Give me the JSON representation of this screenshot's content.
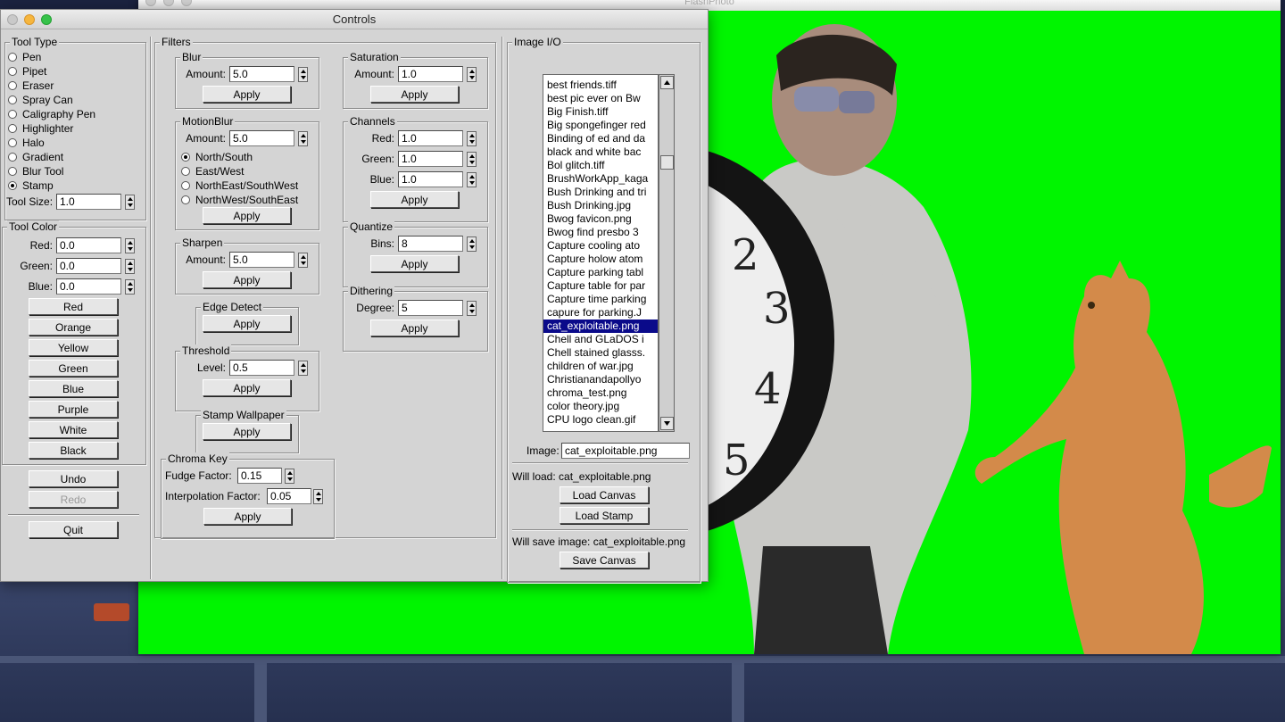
{
  "main_window": {
    "title": "FlashPhoto"
  },
  "controls_window": {
    "title": "Controls"
  },
  "tool_type": {
    "title": "Tool Type",
    "tools": [
      {
        "label": "Pen",
        "selected": false
      },
      {
        "label": "Pipet",
        "selected": false
      },
      {
        "label": "Eraser",
        "selected": false
      },
      {
        "label": "Spray Can",
        "selected": false
      },
      {
        "label": "Caligraphy Pen",
        "selected": false
      },
      {
        "label": "Highlighter",
        "selected": false
      },
      {
        "label": "Halo",
        "selected": false
      },
      {
        "label": "Gradient",
        "selected": false
      },
      {
        "label": "Blur Tool",
        "selected": false
      },
      {
        "label": "Stamp",
        "selected": true
      }
    ],
    "size_label": "Tool Size:",
    "size_value": "1.0"
  },
  "tool_color": {
    "title": "Tool Color",
    "red_label": "Red:",
    "red_value": "0.0",
    "green_label": "Green:",
    "green_value": "0.0",
    "blue_label": "Blue:",
    "blue_value": "0.0",
    "buttons": [
      "Red",
      "Orange",
      "Yellow",
      "Green",
      "Blue",
      "Purple",
      "White",
      "Black"
    ]
  },
  "history": {
    "undo": "Undo",
    "redo": "Redo",
    "quit": "Quit"
  },
  "filters": {
    "title": "Filters",
    "apply": "Apply",
    "blur": {
      "title": "Blur",
      "amount_label": "Amount:",
      "amount": "5.0"
    },
    "motion_blur": {
      "title": "MotionBlur",
      "amount_label": "Amount:",
      "amount": "5.0",
      "directions": [
        {
          "label": "North/South",
          "selected": true
        },
        {
          "label": "East/West",
          "selected": false
        },
        {
          "label": "NorthEast/SouthWest",
          "selected": false
        },
        {
          "label": "NorthWest/SouthEast",
          "selected": false
        }
      ]
    },
    "sharpen": {
      "title": "Sharpen",
      "amount_label": "Amount:",
      "amount": "5.0"
    },
    "edge_detect": {
      "title": "Edge Detect"
    },
    "threshold": {
      "title": "Threshold",
      "level_label": "Level:",
      "level": "0.5"
    },
    "stamp_wallpaper": {
      "title": "Stamp Wallpaper"
    },
    "chroma_key": {
      "title": "Chroma Key",
      "fudge_label": "Fudge Factor:",
      "fudge": "0.15",
      "interp_label": "Interpolation Factor:",
      "interp": "0.05"
    },
    "saturation": {
      "title": "Saturation",
      "amount_label": "Amount:",
      "amount": "1.0"
    },
    "channels": {
      "title": "Channels",
      "red_label": "Red:",
      "red": "1.0",
      "green_label": "Green:",
      "green": "1.0",
      "blue_label": "Blue:",
      "blue": "1.0"
    },
    "quantize": {
      "title": "Quantize",
      "bins_label": "Bins:",
      "bins": "8"
    },
    "dithering": {
      "title": "Dithering",
      "degree_label": "Degree:",
      "degree": "5"
    }
  },
  "image_io": {
    "title": "Image I/O",
    "files": [
      "best friends.tiff",
      "best pic ever on Bw",
      "Big Finish.tiff",
      "Big spongefinger red",
      "Binding of ed and da",
      "black and white bac",
      "Bol glitch.tiff",
      "BrushWorkApp_kaga",
      "Bush Drinking and tri",
      "Bush Drinking.jpg",
      "Bwog favicon.png",
      "Bwog find presbo 3",
      "Capture cooling ato",
      "Capture holow atom",
      "Capture parking tabl",
      "Capture table for par",
      "Capture time parking",
      "capure for parking.J",
      "cat_exploitable.png",
      "Chell and GLaDOS i",
      "Chell stained glasss.",
      "children of war.jpg",
      "Christianandapollyo",
      "chroma_test.png",
      "color theory.jpg",
      "CPU logo clean.gif"
    ],
    "selected_index": 18,
    "image_label": "Image:",
    "image_value": "cat_exploitable.png",
    "will_load": "Will load: cat_exploitable.png",
    "load_canvas": "Load Canvas",
    "load_stamp": "Load Stamp",
    "will_save": "Will save image: cat_exploitable.png",
    "save_canvas": "Save Canvas"
  },
  "colors": {
    "canvas_green": "#00f500",
    "selection": "#0a0a8a",
    "panel": "#d4d4d4"
  }
}
